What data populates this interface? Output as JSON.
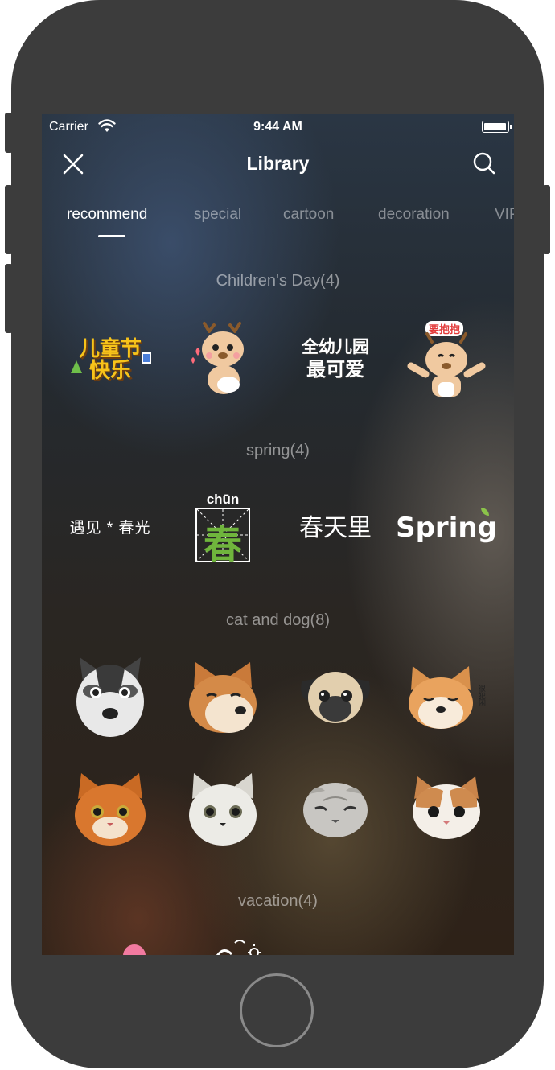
{
  "status_bar": {
    "carrier": "Carrier",
    "time": "9:44 AM"
  },
  "navbar": {
    "title": "Library",
    "close_icon": "close-icon",
    "search_icon": "search-icon"
  },
  "tabs": [
    {
      "label": "recommend",
      "active": true
    },
    {
      "label": "special",
      "active": false
    },
    {
      "label": "cartoon",
      "active": false
    },
    {
      "label": "decoration",
      "active": false
    },
    {
      "label": "VIP",
      "active": false
    }
  ],
  "sections": [
    {
      "title": "Children's Day(4)",
      "stickers": [
        {
          "text_line1": "儿童节",
          "text_line2": "快乐"
        },
        {
          "kind": "cartoon-deer-hug"
        },
        {
          "text_line1": "全幼儿园",
          "text_line2": "最可爱"
        },
        {
          "text_top": "要抱抱",
          "kind": "cartoon-deer-arms"
        }
      ]
    },
    {
      "title": "spring(4)",
      "stickers": [
        {
          "text": "遇见 * 春光"
        },
        {
          "pinyin": "chūn",
          "character": "春"
        },
        {
          "text": "春天里"
        },
        {
          "text": "Spring"
        }
      ]
    },
    {
      "title": "cat and dog(8)",
      "stickers": [
        {
          "kind": "husky"
        },
        {
          "kind": "shiba-inu"
        },
        {
          "kind": "pug"
        },
        {
          "kind": "shiba-sleepy",
          "caption": "很犯困"
        },
        {
          "kind": "orange-cat"
        },
        {
          "kind": "white-cat"
        },
        {
          "kind": "scottish-fold"
        },
        {
          "kind": "exotic-cat"
        }
      ]
    },
    {
      "title": "vacation(4)",
      "stickers": []
    }
  ],
  "colors": {
    "frame": "#3c3c3c",
    "active_tab": "#ffffff",
    "inactive_tab": "rgba(255,255,255,0.45)",
    "sticker_yellow": "#f7c31a",
    "sticker_green": "#8bc34a"
  }
}
